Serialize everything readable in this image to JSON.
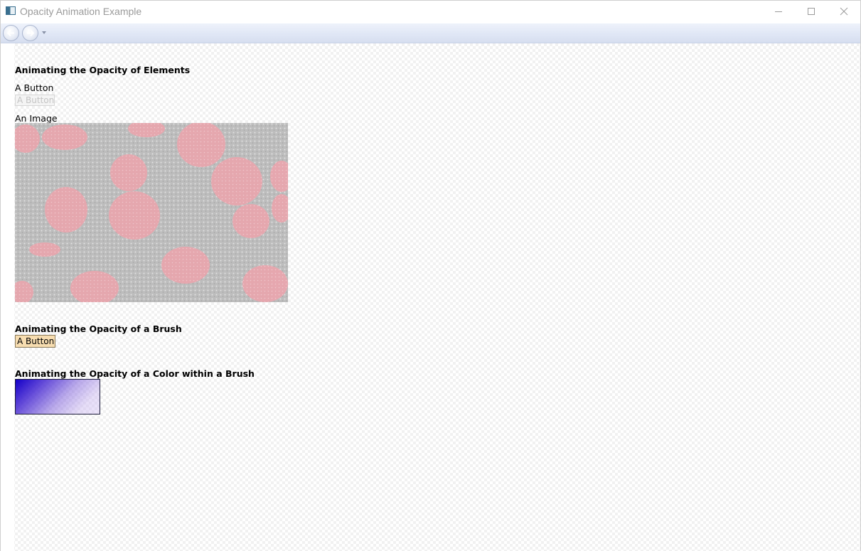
{
  "window": {
    "title": "Opacity Animation Example"
  },
  "icons": {
    "app": "app-window-icon",
    "minimize": "minimize-icon",
    "maximize": "maximize-icon",
    "close": "close-icon",
    "back": "back-arrow-icon",
    "forward": "forward-arrow-icon",
    "history": "chevron-down-icon"
  },
  "content": {
    "section1_heading": "Animating the Opacity of Elements",
    "button_caption": "A Button",
    "faded_button_label": "A Button",
    "image_caption": "An Image",
    "section2_heading": "Animating the Opacity of a Brush",
    "brush_button_label": "A Button",
    "section3_heading": "Animating the Opacity of a Color within a Brush"
  },
  "colors": {
    "brush_button_fill": "#f7ddb0",
    "gradient_start": "#1400c8",
    "gradient_end": "#d2bef5"
  }
}
